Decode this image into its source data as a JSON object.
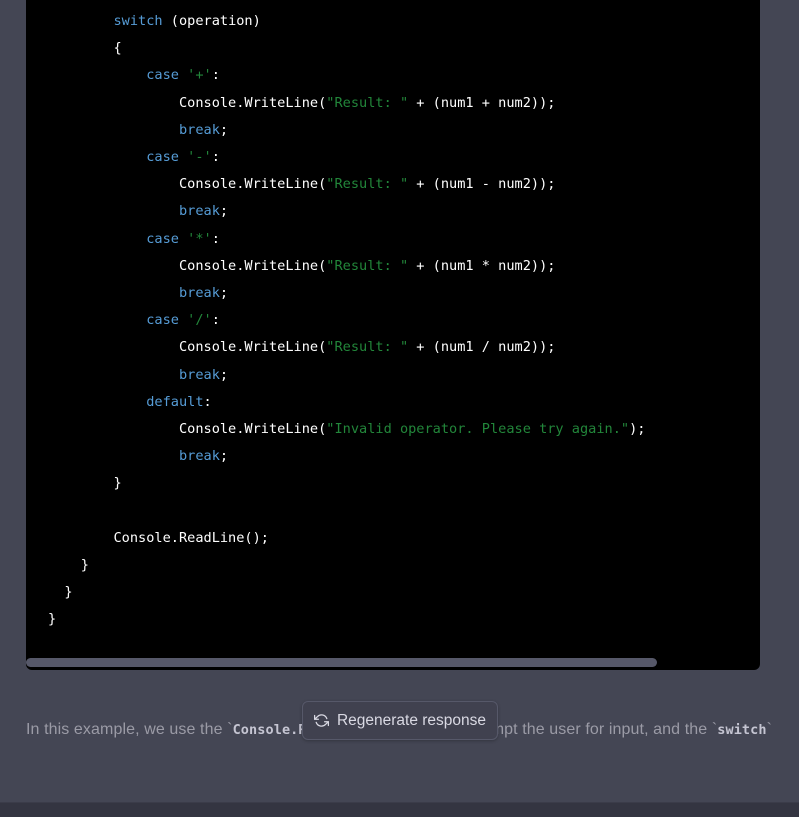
{
  "code_block": {
    "language": "csharp",
    "lines": [
      {
        "indent": 2,
        "tokens": [
          {
            "t": "kw",
            "v": "switch"
          },
          {
            "t": "plain",
            "v": " (operation)"
          }
        ]
      },
      {
        "indent": 2,
        "tokens": [
          {
            "t": "plain",
            "v": "{"
          }
        ]
      },
      {
        "indent": 3,
        "tokens": [
          {
            "t": "kw",
            "v": "case"
          },
          {
            "t": "plain",
            "v": " "
          },
          {
            "t": "str",
            "v": "'+'"
          },
          {
            "t": "plain",
            "v": ":"
          }
        ]
      },
      {
        "indent": 4,
        "tokens": [
          {
            "t": "plain",
            "v": "Console.WriteLine("
          },
          {
            "t": "str",
            "v": "\"Result: \""
          },
          {
            "t": "plain",
            "v": " + (num1 + num2));"
          }
        ]
      },
      {
        "indent": 4,
        "tokens": [
          {
            "t": "kw",
            "v": "break"
          },
          {
            "t": "plain",
            "v": ";"
          }
        ]
      },
      {
        "indent": 3,
        "tokens": [
          {
            "t": "kw",
            "v": "case"
          },
          {
            "t": "plain",
            "v": " "
          },
          {
            "t": "str",
            "v": "'-'"
          },
          {
            "t": "plain",
            "v": ":"
          }
        ]
      },
      {
        "indent": 4,
        "tokens": [
          {
            "t": "plain",
            "v": "Console.WriteLine("
          },
          {
            "t": "str",
            "v": "\"Result: \""
          },
          {
            "t": "plain",
            "v": " + (num1 - num2));"
          }
        ]
      },
      {
        "indent": 4,
        "tokens": [
          {
            "t": "kw",
            "v": "break"
          },
          {
            "t": "plain",
            "v": ";"
          }
        ]
      },
      {
        "indent": 3,
        "tokens": [
          {
            "t": "kw",
            "v": "case"
          },
          {
            "t": "plain",
            "v": " "
          },
          {
            "t": "str",
            "v": "'*'"
          },
          {
            "t": "plain",
            "v": ":"
          }
        ]
      },
      {
        "indent": 4,
        "tokens": [
          {
            "t": "plain",
            "v": "Console.WriteLine("
          },
          {
            "t": "str",
            "v": "\"Result: \""
          },
          {
            "t": "plain",
            "v": " + (num1 * num2));"
          }
        ]
      },
      {
        "indent": 4,
        "tokens": [
          {
            "t": "kw",
            "v": "break"
          },
          {
            "t": "plain",
            "v": ";"
          }
        ]
      },
      {
        "indent": 3,
        "tokens": [
          {
            "t": "kw",
            "v": "case"
          },
          {
            "t": "plain",
            "v": " "
          },
          {
            "t": "str",
            "v": "'/'"
          },
          {
            "t": "plain",
            "v": ":"
          }
        ]
      },
      {
        "indent": 4,
        "tokens": [
          {
            "t": "plain",
            "v": "Console.WriteLine("
          },
          {
            "t": "str",
            "v": "\"Result: \""
          },
          {
            "t": "plain",
            "v": " + (num1 / num2));"
          }
        ]
      },
      {
        "indent": 4,
        "tokens": [
          {
            "t": "kw",
            "v": "break"
          },
          {
            "t": "plain",
            "v": ";"
          }
        ]
      },
      {
        "indent": 3,
        "tokens": [
          {
            "t": "kw",
            "v": "default"
          },
          {
            "t": "plain",
            "v": ":"
          }
        ]
      },
      {
        "indent": 4,
        "tokens": [
          {
            "t": "plain",
            "v": "Console.WriteLine("
          },
          {
            "t": "str",
            "v": "\"Invalid operator. Please try again.\""
          },
          {
            "t": "plain",
            "v": ");"
          }
        ]
      },
      {
        "indent": 4,
        "tokens": [
          {
            "t": "kw",
            "v": "break"
          },
          {
            "t": "plain",
            "v": ";"
          }
        ]
      },
      {
        "indent": 2,
        "tokens": [
          {
            "t": "plain",
            "v": "}"
          }
        ]
      },
      {
        "indent": 0,
        "tokens": []
      },
      {
        "indent": 2,
        "tokens": [
          {
            "t": "plain",
            "v": "Console.ReadLine();"
          }
        ]
      },
      {
        "indent": 1,
        "tokens": [
          {
            "t": "plain",
            "v": "}"
          }
        ]
      },
      {
        "indent": 1,
        "tokens": [
          {
            "t": "plain",
            "v": "}",
            "half": true
          }
        ]
      },
      {
        "indent": 0,
        "tokens": [
          {
            "t": "plain",
            "v": "}"
          }
        ]
      }
    ],
    "colors": {
      "background": "#000000",
      "keyword": "#569cd6",
      "string": "#22863a",
      "plain": "#ffffff",
      "scrollbar_thumb": "#565869"
    },
    "scrollbar": {
      "orientation": "horizontal",
      "thumb_fraction": 0.86
    }
  },
  "paragraph": {
    "segments": [
      {
        "type": "text",
        "v": "In this example, we use the "
      },
      {
        "type": "code",
        "v": "Console.ReadLine()"
      },
      {
        "type": "text",
        "v": " method to prompt the user for input, and the "
      },
      {
        "type": "code",
        "v": "switch"
      },
      {
        "type": "text",
        "v": ""
      }
    ],
    "visible_text": "In this example, we use the `Console.ReadLine()` method to prompt the user for input, and the `switch`"
  },
  "regenerate_button": {
    "label": "Regenerate response",
    "icon": "refresh-icon",
    "background": "#40414f",
    "border_color": "#565869",
    "text_color": "#d9d9e3"
  },
  "theme": {
    "message_background": "#444654",
    "bottom_bar_background": "#343541",
    "body_text_color": "#9b9ba6",
    "inline_code_color": "#c5c5d2"
  }
}
